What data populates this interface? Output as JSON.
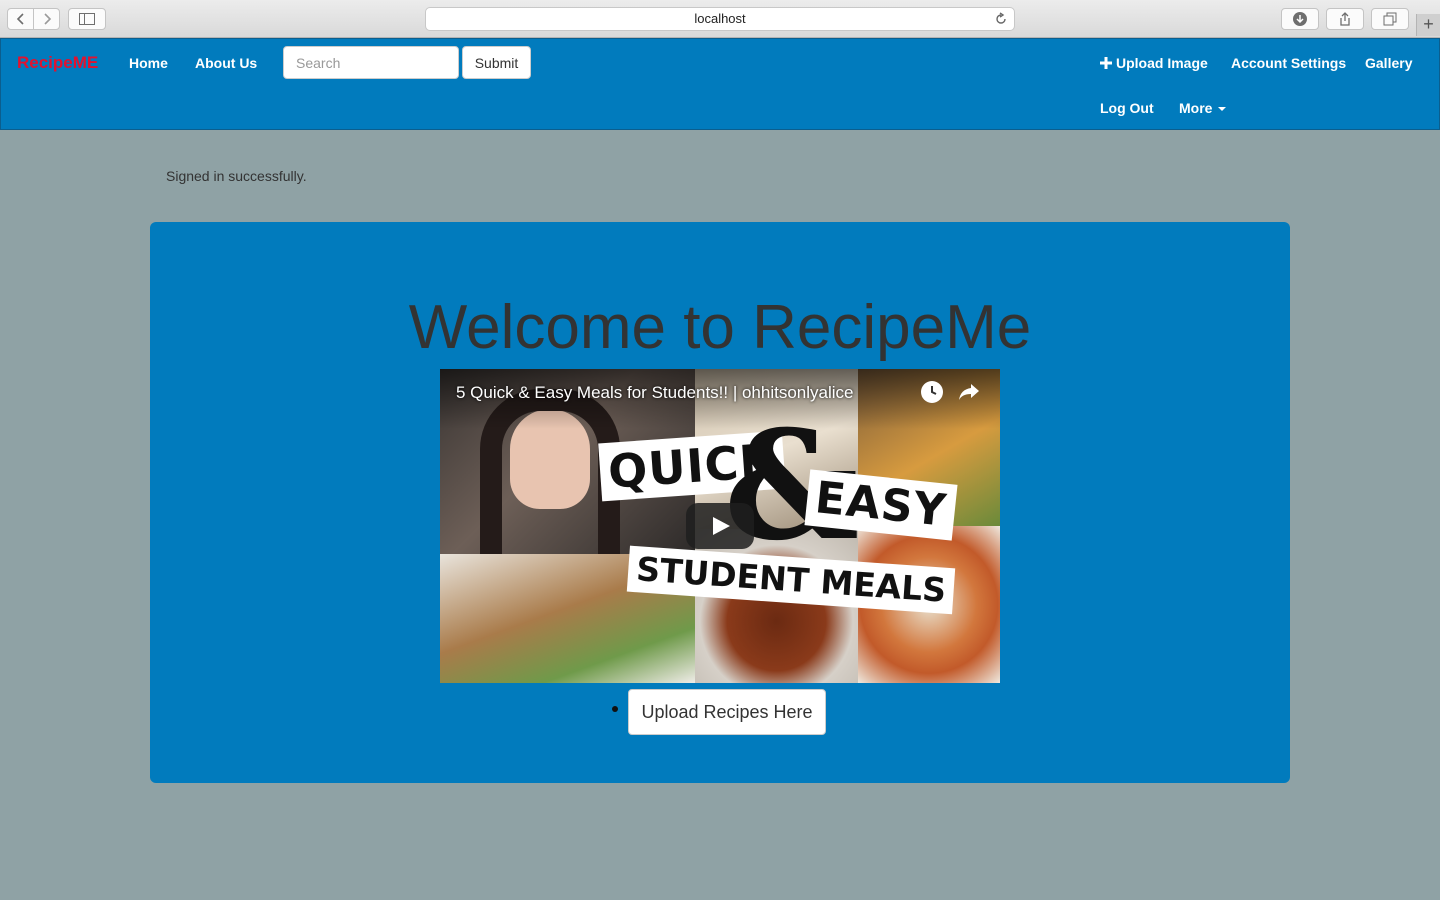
{
  "browser": {
    "url": "localhost"
  },
  "navbar": {
    "brand": "RecipeME",
    "home": "Home",
    "about": "About Us",
    "search_placeholder": "Search",
    "submit": "Submit",
    "upload_image": "Upload Image",
    "account_settings": "Account Settings",
    "gallery": "Gallery",
    "log_out": "Log Out",
    "more": "More"
  },
  "flash": "Signed in successfully.",
  "main": {
    "heading": "Welcome to RecipeMe",
    "video_title": "5 Quick & Easy Meals for Students!! | ohhitsonlyalice",
    "thumbnail_text": {
      "quick": "QUICK",
      "amp": "&",
      "easy": "EASY",
      "student_meals": "STUDENT MEALS"
    },
    "upload_button": "Upload Recipes Here"
  }
}
